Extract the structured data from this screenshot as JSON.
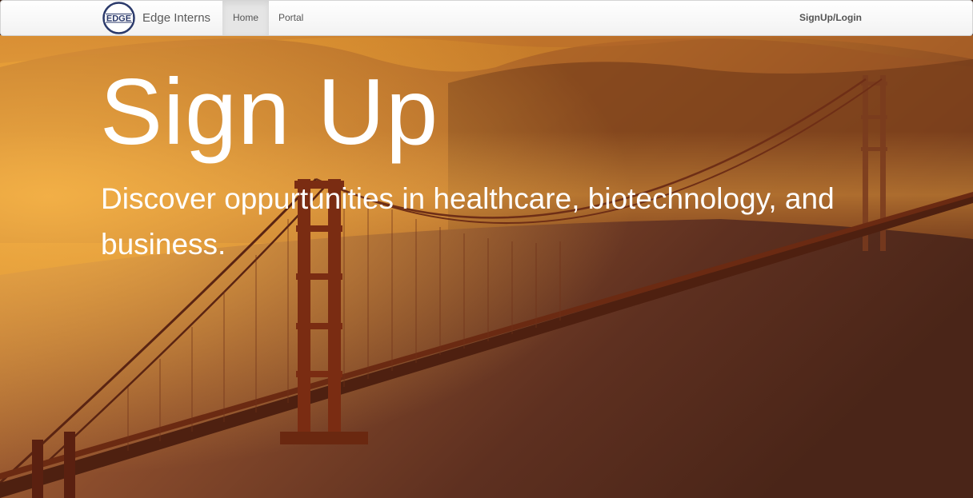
{
  "navbar": {
    "logo_icon": "edge-logo-icon",
    "brand": "Edge Interns",
    "items": [
      {
        "label": "Home",
        "active": true
      },
      {
        "label": "Portal",
        "active": false
      }
    ],
    "right_link": "SignUp/Login"
  },
  "hero": {
    "title": "Sign Up",
    "subtitle": "Discover oppurtunities in healthcare, biotechnology, and business.",
    "background_image": "golden-gate-bridge-sunset-photo"
  },
  "colors": {
    "navbar_bg": "#f8f8f8",
    "active_tab_bg": "#e5e5e5",
    "hero_text": "#ffffff",
    "sky_gold": "#e8a030",
    "water_dark": "#4a2618"
  }
}
